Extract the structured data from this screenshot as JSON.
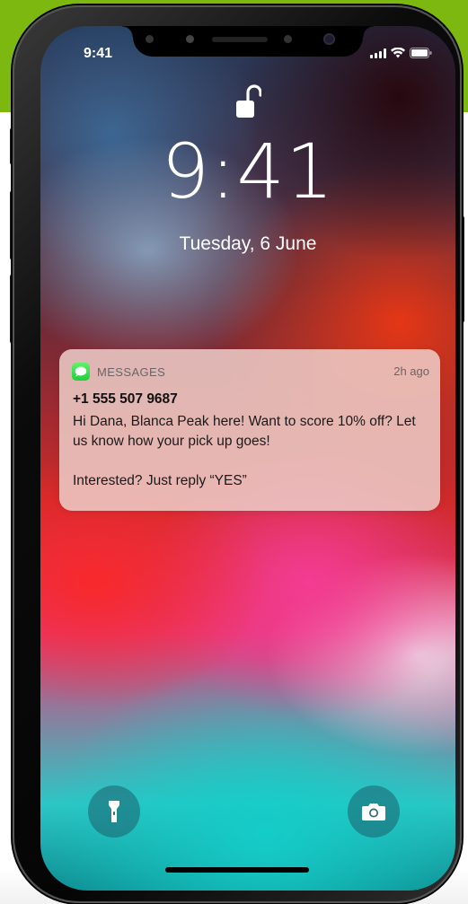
{
  "colors": {
    "brand_band": "#7cb80f",
    "messages_icon": "#2bd64a"
  },
  "status_bar": {
    "time": "9:41",
    "icons": [
      "signal-icon",
      "wifi-icon",
      "battery-icon"
    ]
  },
  "lock_screen": {
    "icon": "lock-open-icon",
    "clock": "9:41",
    "date": "Tuesday, 6 June"
  },
  "notification": {
    "app_icon": "messages-icon",
    "app_name": "MESSAGES",
    "time": "2h ago",
    "sender": "+1 555 507 9687",
    "body_lines": [
      "Hi Dana, Blanca Peak here! Want to score 10% off?  Let us know how your pick up goes!",
      "Interested? Just reply “YES”"
    ]
  },
  "bottom_controls": {
    "left_icon": "flashlight-icon",
    "right_icon": "camera-icon"
  }
}
